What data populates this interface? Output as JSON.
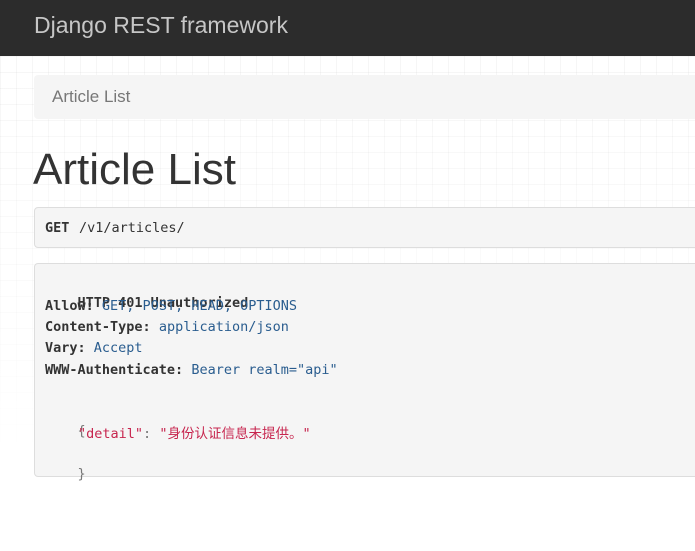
{
  "navbar": {
    "brand": "Django REST framework"
  },
  "breadcrumb": {
    "items": [
      "Article List"
    ]
  },
  "page": {
    "title": "Article List"
  },
  "request": {
    "method": "GET",
    "path": "/v1/articles/"
  },
  "response": {
    "status_line": "HTTP 401 Unauthorized",
    "headers": [
      {
        "name": "Allow:",
        "value": "GET, POST, HEAD, OPTIONS"
      },
      {
        "name": "Content-Type:",
        "value": "application/json"
      },
      {
        "name": "Vary:",
        "value": "Accept"
      },
      {
        "name": "WWW-Authenticate:",
        "value": "Bearer realm=\"api\""
      }
    ],
    "body": {
      "open_brace": "{",
      "key": "\"detail\"",
      "colon": ":",
      "value": "\"身份认证信息未提供。\"",
      "close_brace": "}"
    }
  },
  "colors": {
    "navbar_bg": "#2c2c2c",
    "brand": "#c6c6c6",
    "header_value": "#2a5d8f",
    "json_string": "#c7254e"
  }
}
